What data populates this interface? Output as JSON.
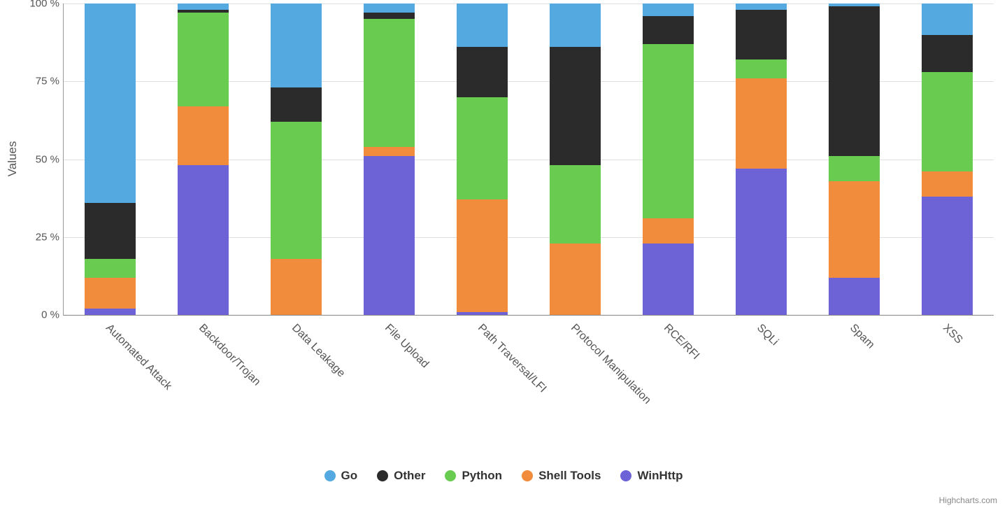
{
  "chart_data": {
    "type": "bar",
    "stacked_percent": true,
    "ylabel": "Values",
    "ylim": [
      0,
      100
    ],
    "yticks": [
      0,
      25,
      50,
      75,
      100
    ],
    "ytick_labels": [
      "0 %",
      "25 %",
      "50 %",
      "75 %",
      "100 %"
    ],
    "categories": [
      "Automated Attack",
      "Backdoor/Trojan",
      "Data Leakage",
      "File Upload",
      "Path Traversal/LFI",
      "Protocol Manipulation",
      "RCE/RFI",
      "SQLi",
      "Spam",
      "XSS"
    ],
    "series": [
      {
        "name": "Go",
        "color": "#53A9E0",
        "values": [
          64,
          2,
          27,
          3,
          14,
          14,
          4,
          2,
          1,
          10
        ]
      },
      {
        "name": "Other",
        "color": "#2B2B2B",
        "values": [
          18,
          1,
          11,
          2,
          16,
          38,
          9,
          16,
          48,
          12
        ]
      },
      {
        "name": "Python",
        "color": "#69CB50",
        "values": [
          6,
          30,
          44,
          41,
          33,
          25,
          56,
          6,
          8,
          32
        ]
      },
      {
        "name": "Shell Tools",
        "color": "#F08C3C",
        "values": [
          10,
          19,
          18,
          3,
          36,
          23,
          8,
          29,
          31,
          8
        ]
      },
      {
        "name": "WinHttp",
        "color": "#6D63D6",
        "values": [
          2,
          48,
          0,
          51,
          1,
          0,
          23,
          47,
          12,
          38
        ]
      }
    ]
  },
  "legend": {
    "items": [
      {
        "label": "Go",
        "color": "#53A9E0"
      },
      {
        "label": "Other",
        "color": "#2B2B2B"
      },
      {
        "label": "Python",
        "color": "#69CB50"
      },
      {
        "label": "Shell Tools",
        "color": "#F08C3C"
      },
      {
        "label": "WinHttp",
        "color": "#6D63D6"
      }
    ]
  },
  "credits": "Highcharts.com"
}
